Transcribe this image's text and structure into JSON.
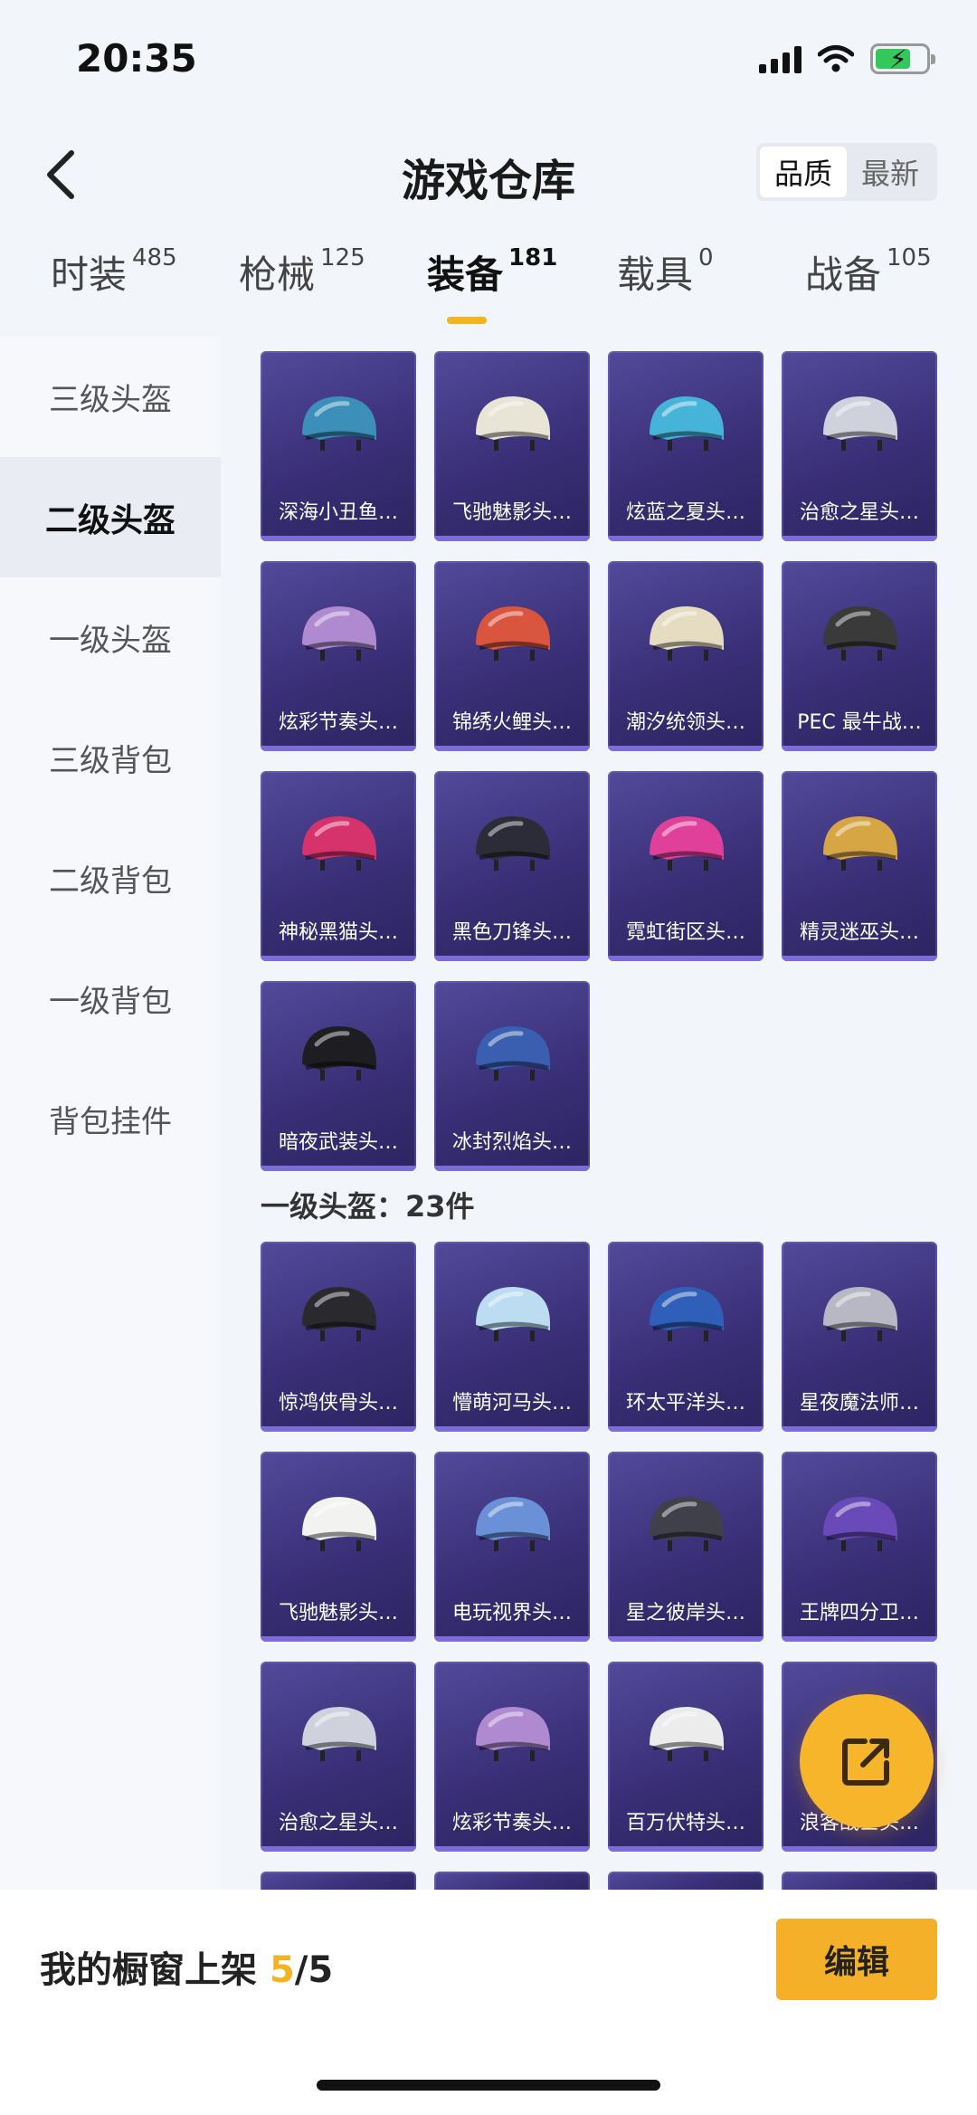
{
  "status": {
    "time": "20:35"
  },
  "header": {
    "title": "游戏仓库",
    "sort_quality": "品质",
    "sort_newest": "最新"
  },
  "categories": [
    {
      "label": "时装",
      "count": "485"
    },
    {
      "label": "枪械",
      "count": "125"
    },
    {
      "label": "装备",
      "count": "181",
      "active": true
    },
    {
      "label": "载具",
      "count": "0"
    },
    {
      "label": "战备",
      "count": "105"
    }
  ],
  "sidebar": {
    "items": [
      {
        "label": "三级头盔"
      },
      {
        "label": "二级头盔",
        "active": true
      },
      {
        "label": "一级头盔"
      },
      {
        "label": "三级背包"
      },
      {
        "label": "二级背包"
      },
      {
        "label": "一级背包"
      },
      {
        "label": "背包挂件"
      }
    ]
  },
  "level2_items": [
    {
      "label": "深海小丑鱼…",
      "helmet_color": "#3b8fb8"
    },
    {
      "label": "飞驰魅影头…",
      "helmet_color": "#e8e4d6"
    },
    {
      "label": "炫蓝之夏头…",
      "helmet_color": "#46b4d8"
    },
    {
      "label": "治愈之星头…",
      "helmet_color": "#cfd2dc"
    },
    {
      "label": "炫彩节奏头…",
      "helmet_color": "#b08ad0"
    },
    {
      "label": "锦绣火鲤头…",
      "helmet_color": "#d9553e"
    },
    {
      "label": "潮汐统领头…",
      "helmet_color": "#e6dcc2"
    },
    {
      "label": "PEC 最牛战…",
      "helmet_color": "#3a3a3a"
    },
    {
      "label": "神秘黑猫头…",
      "helmet_color": "#d6336c"
    },
    {
      "label": "黑色刀锋头…",
      "helmet_color": "#2c2c38"
    },
    {
      "label": "霓虹街区头…",
      "helmet_color": "#e0409a"
    },
    {
      "label": "精灵迷巫头…",
      "helmet_color": "#d6a544"
    },
    {
      "label": "暗夜武装头…",
      "helmet_color": "#1e1e22"
    },
    {
      "label": "冰封烈焰头…",
      "helmet_color": "#3a5fb0"
    }
  ],
  "level1_section": "一级头盔：23件",
  "level1_items": [
    {
      "label": "惊鸿侠骨头…",
      "helmet_color": "#2a2a2e"
    },
    {
      "label": "懵萌河马头…",
      "helmet_color": "#bcdcf2"
    },
    {
      "label": "环太平洋头…",
      "helmet_color": "#2f5fb8"
    },
    {
      "label": "星夜魔法师…",
      "helmet_color": "#b8b8c4"
    },
    {
      "label": "飞驰魅影头…",
      "helmet_color": "#f2f2f0"
    },
    {
      "label": "电玩视界头…",
      "helmet_color": "#6a90d8"
    },
    {
      "label": "星之彼岸头…",
      "helmet_color": "#40404a"
    },
    {
      "label": "王牌四分卫…",
      "helmet_color": "#6a4ab8"
    },
    {
      "label": "治愈之星头…",
      "helmet_color": "#cfd2dc"
    },
    {
      "label": "炫彩节奏头…",
      "helmet_color": "#b08ad0"
    },
    {
      "label": "百万伏特头…",
      "helmet_color": "#ececec"
    },
    {
      "label": "浪客战士头…",
      "helmet_color": "#5a5a66"
    }
  ],
  "bottom": {
    "showcase_label": "我的橱窗上架",
    "showcase_count": "5",
    "showcase_total": "/5",
    "edit_label": "编辑"
  },
  "colors": {
    "accent": "#f4b321",
    "card_bg": "#3a2f78"
  }
}
